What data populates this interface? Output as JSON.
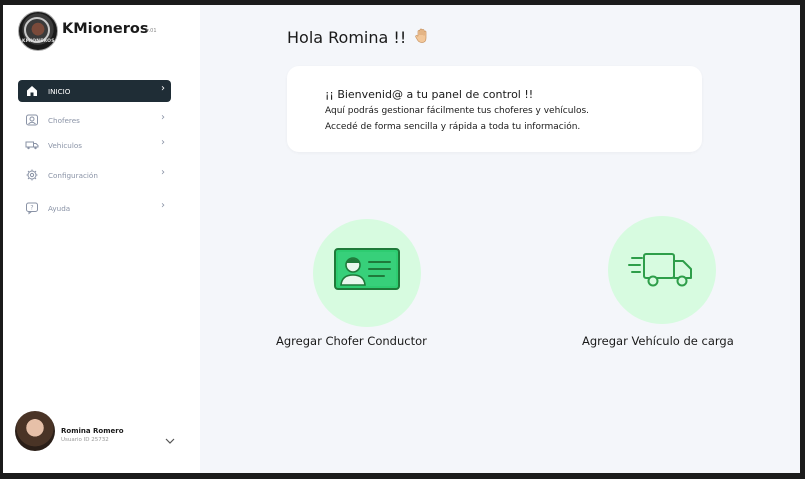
{
  "brand": {
    "name": "KMioneros",
    "version": "v.01",
    "logo_text": "KMIONEROS"
  },
  "sidebar": {
    "items": [
      {
        "label": "INICIO",
        "icon": "home-icon",
        "active": true
      },
      {
        "label": "Choferes",
        "icon": "driver-icon",
        "active": false
      },
      {
        "label": "Vehiculos",
        "icon": "truck-icon",
        "active": false
      },
      {
        "label": "Configuración",
        "icon": "gear-icon",
        "active": false
      },
      {
        "label": "Ayuda",
        "icon": "help-icon",
        "active": false
      }
    ]
  },
  "user": {
    "name": "Romina Romero",
    "id_label": "Usuario ID 25732"
  },
  "header": {
    "greeting": "Hola Romina !!"
  },
  "welcome": {
    "title": "¡¡ Bienvenid@ a tu panel de control !!",
    "line1": "Aquí podrás gestionar fácilmente tus choferes y vehículos.",
    "line2": "Accedé de forma sencilla y rápida a toda tu información."
  },
  "actions": {
    "add_driver": "Agregar Chofer Conductor",
    "add_vehicle": "Agregar Vehículo de carga"
  },
  "colors": {
    "accent_dark": "#1f2d36",
    "mint": "#d7fbe0",
    "green": "#2e9e4a",
    "background": "#f4f6fa"
  }
}
